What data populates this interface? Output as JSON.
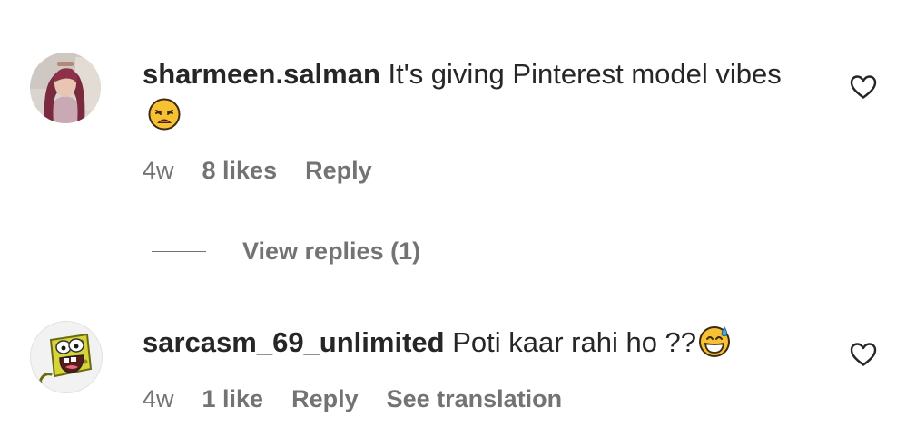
{
  "comments": [
    {
      "username": "sharmeen.salman",
      "text": "It's giving Pinterest model vibes",
      "emoji": "weary-face-emoji",
      "time": "4w",
      "likes": "8 likes",
      "reply_label": "Reply",
      "avatar": "profile-photo-woman",
      "view_replies": "View replies (1)"
    },
    {
      "username": "sarcasm_69_unlimited",
      "text": "Poti kaar rahi ho ??",
      "emoji": "grinning-sweat-emoji",
      "time": "4w",
      "likes": "1 like",
      "reply_label": "Reply",
      "translate_label": "See translation",
      "avatar": "spongebob-avatar"
    }
  ],
  "icons": {
    "like": "heart-outline-icon"
  },
  "colors": {
    "text_primary": "#262626",
    "text_secondary": "#737373",
    "emoji_yellow": "#f6c234"
  }
}
